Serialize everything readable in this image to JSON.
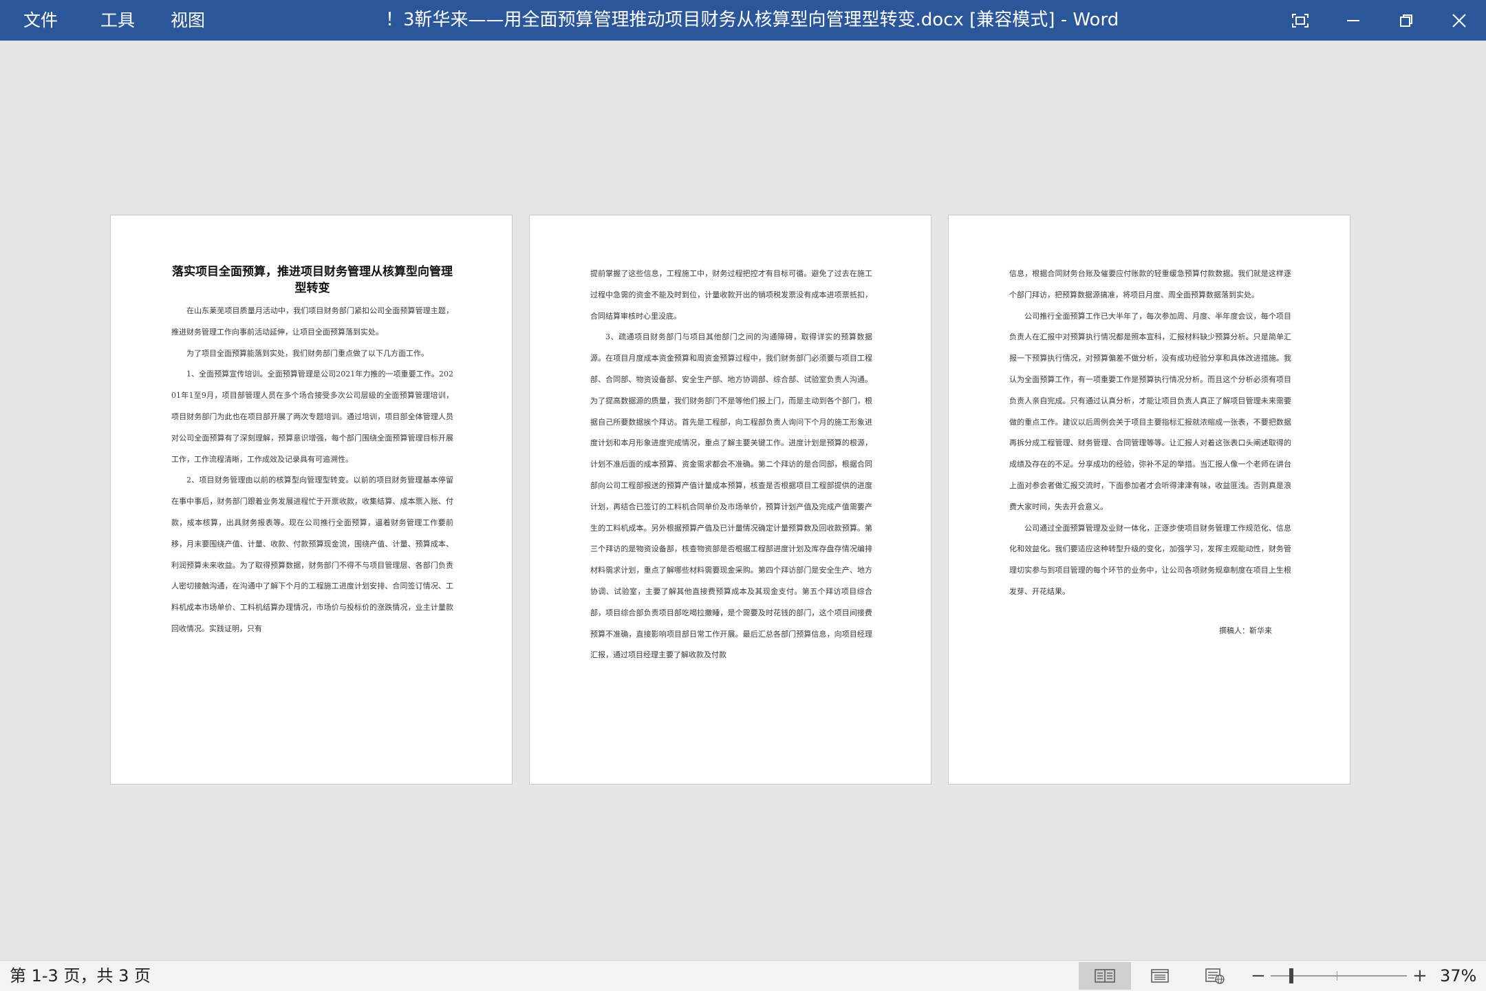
{
  "menu": {
    "file": "文件",
    "tools": "工具",
    "view": "视图"
  },
  "window": {
    "title": "！3靳华来——用全面预算管理推动项目财务从核算型向管理型转变.docx [兼容模式]  -  Word"
  },
  "icons": {
    "focus": "focus-mode-icon",
    "minimize": "minimize-icon",
    "restore": "restore-icon",
    "close": "close-icon",
    "read_mode": "read-mode-icon",
    "print_layout": "print-layout-icon",
    "web_layout": "web-layout-icon"
  },
  "colors": {
    "titlebar": "#2b579a",
    "workspace": "#e6e6e6"
  },
  "document": {
    "heading": "落实项目全面预算，推进项目财务管理从核算型向管理型转变",
    "page1": [
      "在山东莱芜项目质量月活动中，我们项目财务部门紧扣公司全面预算管理主题，推进财务管理工作向事前活动延伸，让项目全面预算落到实处。",
      "为了项目全面预算能落到实处，我们财务部门重点做了以下几方面工作。",
      "1、全面预算宣传培训。全面预算管理是公司2021年力推的一项重要工作。20201年1至9月，项目部管理人员在多个场合接受多次公司层级的全面预算管理培训，项目财务部门为此也在项目部开展了两次专题培训。通过培训，项目部全体管理人员对公司全面预算有了深刻理解，预算意识增强，每个部门围绕全面预算管理目标开展工作，工作流程清晰，工作成效及记录具有可追溯性。",
      "2、项目财务管理由以前的核算型向管理型转变。以前的项目财务管理基本停留在事中事后，财务部门跟着业务发展进程忙于开票收款，收集结算、成本票入账、付款，成本核算，出具财务报表等。现在公司推行全面预算，逼着财务管理工作要前移，月末要围绕产值、计量、收款、付款预算现金流，围绕产值、计量、预算成本、利润预算未来收益。为了取得预算数据，财务部门不得不与项目管理层、各部门负责人密切接触沟通，在沟通中了解下个月的工程施工进度计划安排、合同签订情况、工料机成本市场单价、工料机结算办理情况，市场价与投标价的涨跌情况，业主计量款回收情况。实践证明，只有"
    ],
    "page2": [
      "提前掌握了这些信息，工程施工中，财务过程把控才有目标可循。避免了过去在施工过程中急需的资金不能及时到位，计量收款开出的销项税发票没有成本进项票抵扣，合同结算审核时心里没底。",
      "3、疏通项目财务部门与项目其他部门之间的沟通障碍，取得详实的预算数据源。在项目月度成本资金预算和周资金预算过程中，我们财务部门必须要与项目工程部、合同部、物资设备部、安全生产部、地方协调部、综合部、试验室负责人沟通。为了提高数据源的质量，我们财务部门不是等他们报上门，而是主动到各个部门，根据自己所要数据挨个拜访。首先是工程部，向工程部负责人询问下个月的施工形象进度计划和本月形象进度完成情况，重点了解主要关键工作。进度计划是预算的根源，计划不准后面的成本预算、资金需求都会不准确。第二个拜访的是合同部，根据合同部向公司工程部报送的预算产值计量成本预算，核查是否根据项目工程部提供的进度计划，再结合已签订的工料机合同单价及市场单价，预算计划产值及完成产值需要产生的工料机成本。另外根据预算产值及已计量情况确定计量预算数及回收款预算。第三个拜访的是物资设备部，核查物资部是否根据工程部进度计划及库存盘存情况编排材料需求计划，重点了解哪些材料需要现金采购。第四个拜访部门是安全生产、地方协调、试验室，主要了解其他直接费预算成本及其现金支付。第五个拜访项目综合部，项目综合部负责项目部吃喝拉撒睡，是个需要及时花钱的部门，这个项目间接费预算不准确，直接影响项目部日常工作开展。最后汇总各部门预算信息，向项目经理汇报，通过项目经理主要了解收款及付款"
    ],
    "page3": [
      "信息，根据合同财务台账及催要应付账款的轻重缓急预算付款数据。我们就是这样逐个部门拜访，把预算数据源搞准，将项目月度、周全面预算数据落到实处。",
      "公司推行全面预算工作已大半年了，每次参加周、月度、半年度会议，每个项目负责人在汇报中对预算执行情况都是照本宣科，汇报材料缺少预算分析。只是简单汇报一下预算执行情况，对预算偏差不做分析，没有成功经验分享和具体改进措施。我认为全面预算工作，有一项重要工作是预算执行情况分析。而且这个分析必须有项目负责人亲自完成。只有通过认真分析，才能让项目负责人真正了解项目管理未来需要做的重点工作。建议以后周例会关于项目主要指标汇报就浓缩成一张表，不要把数据再拆分成工程管理、财务管理、合同管理等等。让汇报人对着这张表口头阐述取得的成绩及存在的不足。分享成功的经验，弥补不足的举措。当汇报人像一个老师在讲台上面对参会者做汇报交流时，下面参加者才会听得津津有味，收益匪浅。否则真是浪费大家时间，失去开会意义。",
      "公司通过全面预算管理及业财一体化，正逐步使项目财务管理工作规范化、信息化和效益化。我们要适应这种转型升级的变化，加强学习，发挥主观能动性，财务管理切实参与到项目管理的每个环节的业务中，让公司各项财务规章制度在项目上生根发芽、开花结果。"
    ],
    "signature": "撰稿人：靳华来"
  },
  "status": {
    "page_count": "第 1-3 页，共 3 页",
    "zoom_minus": "−",
    "zoom_plus": "+",
    "zoom_level": "37%",
    "zoom_value": 37
  }
}
